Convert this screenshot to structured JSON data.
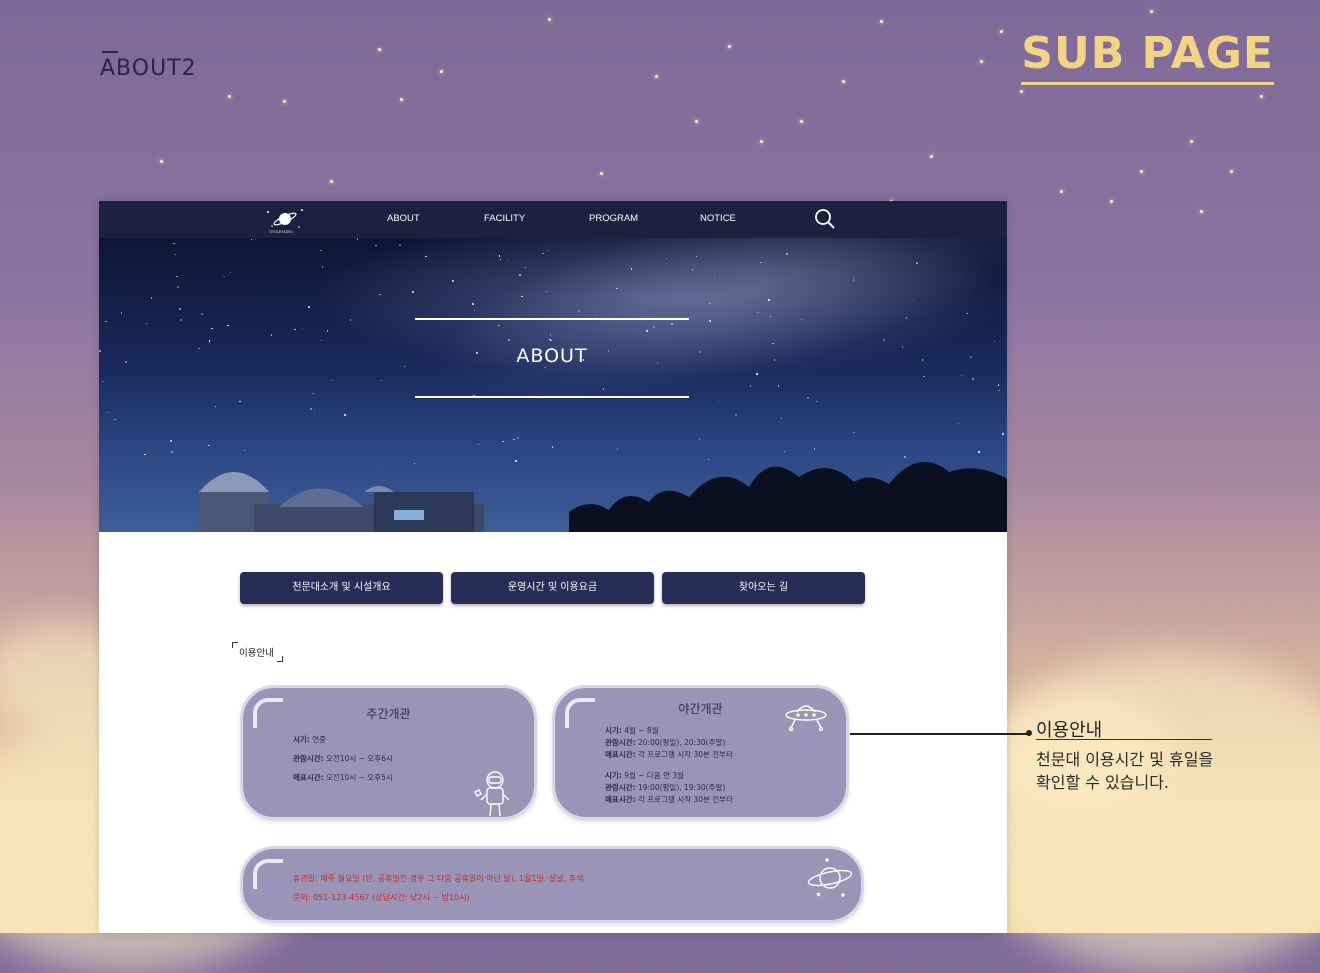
{
  "page": {
    "label": "ABOUT2",
    "badge": "SUB PAGE"
  },
  "nav": {
    "logo_text": "ONSEMIRO",
    "items": [
      "ABOUT",
      "FACILITY",
      "PROGRAM",
      "NOTICE"
    ],
    "search_icon": "search-icon"
  },
  "hero": {
    "title": "ABOUT"
  },
  "tabs": [
    "천문대소개 및 시설개요",
    "운영시간 및 이용요금",
    "찾아오는 길"
  ],
  "section": {
    "label": "이용안내"
  },
  "day_card": {
    "title": "주간개관",
    "lines": [
      {
        "k": "시기:",
        "v": " 연중"
      },
      {
        "k": "관람시간:",
        "v": " 오전10시 ~ 오후6시"
      },
      {
        "k": "매표시간:",
        "v": " 오전10시 ~ 오후5시"
      }
    ],
    "icon": "astronaut-icon"
  },
  "night_card": {
    "title": "야간개관",
    "lines": [
      {
        "k": "시기:",
        "v": " 4월 ~ 8월"
      },
      {
        "k": "관람시간:",
        "v": " 20:00(평일), 20:30(주말)"
      },
      {
        "k": "매표시간:",
        "v": " 각 프로그램 시작 30분 전부터"
      },
      {
        "k": "시기:",
        "v": " 9월 ~ 다음 연 3월"
      },
      {
        "k": "관람시간:",
        "v": " 19:00(평일), 19:30(주말)"
      },
      {
        "k": "매표시간:",
        "v": " 각 프로그램 시작 30분 전부터"
      }
    ],
    "icon": "ufo-icon"
  },
  "holiday_card": {
    "closed": "휴관일: 매주 월요일 (단, 공휴일인 경우 그 다음 공휴일이 아닌 날), 1월1일, 설날, 추석",
    "contact": "문의: 051-123-4567 (상담시간: 낮2시 ~ 밤10시)",
    "icon": "planet-icon"
  },
  "callout": {
    "title": "이용안내",
    "desc_line1": "천문대 이용시간 및 휴일을",
    "desc_line2": "확인할 수 있습니다."
  },
  "colors": {
    "nav_bg": "#1c2140",
    "tab_bg": "#262d57",
    "card_bg": "#9a95b7",
    "accent_gold": "#f3d385",
    "alert_red": "#c72a2a"
  }
}
